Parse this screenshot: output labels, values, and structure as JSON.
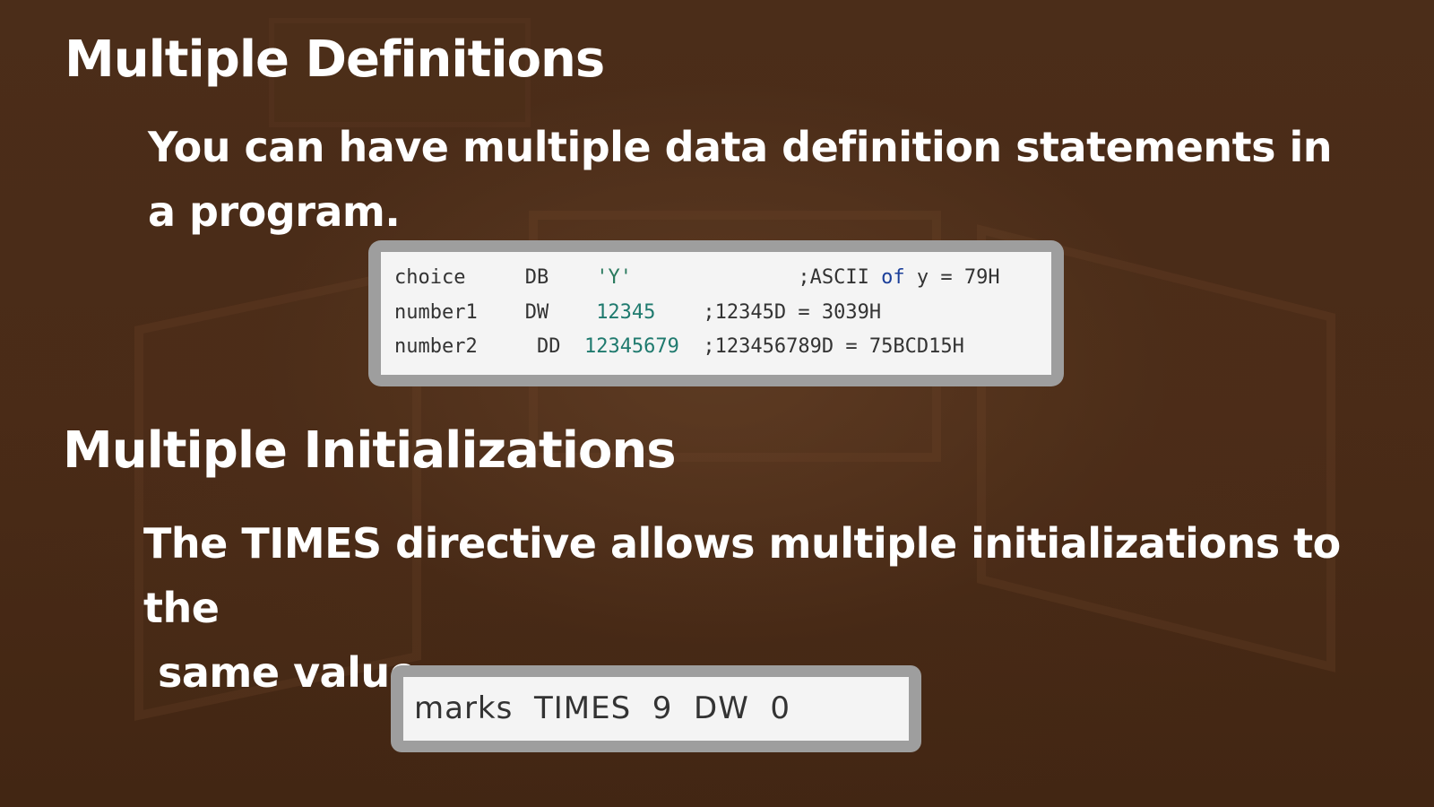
{
  "slide": {
    "heading1": "Multiple Definitions",
    "para1": "You can have multiple data definition statements in a program.",
    "code1": [
      {
        "label": "choice",
        "directive": "DB",
        "value": "'Y'",
        "comment_pre": ";ASCII ",
        "comment_of": "of",
        "comment_post": " y = 79H"
      },
      {
        "label": "number1",
        "directive": "DW",
        "value": "12345",
        "comment": ";12345D = 3039H"
      },
      {
        "label": "number2",
        "directive": "DD",
        "value": "12345679",
        "comment": ";123456789D = 75BCD15H"
      }
    ],
    "heading2": "Multiple Initializations",
    "para2_line1": "The TIMES directive allows multiple initializations to the",
    "para2_line2": "same value.",
    "code2": "marks  TIMES  9  DW  0"
  }
}
